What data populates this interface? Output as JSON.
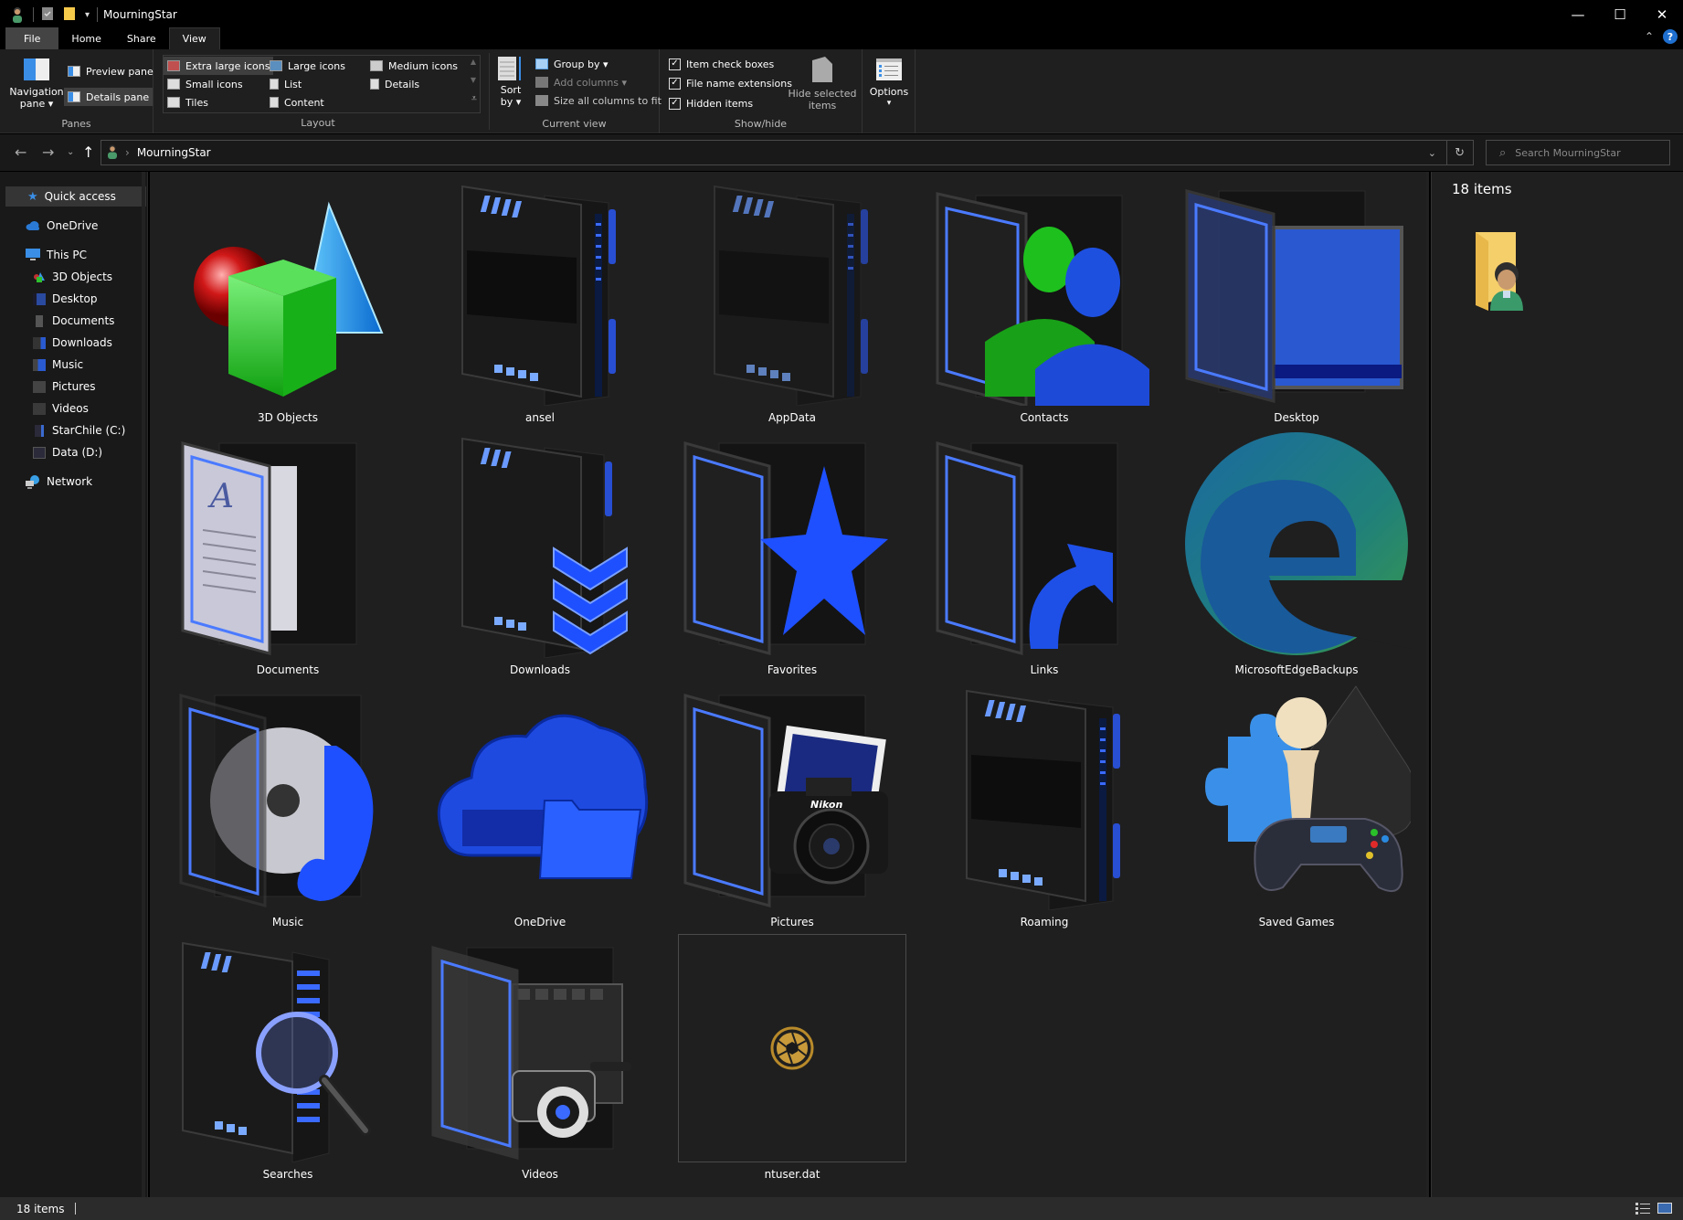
{
  "window": {
    "title": "MourningStar",
    "controls": {
      "minimize": "—",
      "maximize": "☐",
      "close": "✕"
    }
  },
  "ribbon_tabs": [
    "File",
    "Home",
    "Share",
    "View"
  ],
  "ribbon_active_tab": "View",
  "ribbon": {
    "panes": {
      "label": "Panes",
      "navigation_pane": "Navigation pane",
      "navigation_pane_line1": "Navigation",
      "navigation_pane_line2": "pane ▾",
      "preview_pane": "Preview pane",
      "details_pane": "Details pane"
    },
    "layout": {
      "label": "Layout",
      "options": [
        "Extra large icons",
        "Large icons",
        "Medium icons",
        "Small icons",
        "List",
        "Details",
        "Tiles",
        "Content"
      ],
      "selected": "Extra large icons"
    },
    "current_view": {
      "label": "Current view",
      "sort_line1": "Sort",
      "sort_line2": "by ▾",
      "group_by": "Group by ▾",
      "add_columns": "Add columns ▾",
      "size_columns": "Size all columns to fit"
    },
    "show_hide": {
      "label": "Show/hide",
      "item_check_boxes": "Item check boxes",
      "file_name_extensions": "File name extensions",
      "hidden_items": "Hidden items",
      "item_check_boxes_checked": true,
      "file_name_extensions_checked": true,
      "hidden_items_checked": true,
      "hide_selected_line1": "Hide selected",
      "hide_selected_line2": "items"
    },
    "options": {
      "label": "Options",
      "caret": "▾"
    }
  },
  "address_bar": {
    "path": [
      "MourningStar"
    ],
    "separator": "›",
    "search_placeholder": "Search MourningStar"
  },
  "nav": {
    "quick_access": "Quick access",
    "onedrive": "OneDrive",
    "this_pc": "This PC",
    "pc_items": [
      "3D Objects",
      "Desktop",
      "Documents",
      "Downloads",
      "Music",
      "Pictures",
      "Videos",
      "StarChile (C:)",
      "Data (D:)"
    ],
    "network": "Network"
  },
  "items": [
    {
      "name": "3D Objects",
      "icon": "3d-objects-icon"
    },
    {
      "name": "ansel",
      "icon": "tech-folder-icon"
    },
    {
      "name": "AppData",
      "icon": "tech-folder-icon"
    },
    {
      "name": "Contacts",
      "icon": "contacts-folder-icon"
    },
    {
      "name": "Desktop",
      "icon": "desktop-folder-icon"
    },
    {
      "name": "Documents",
      "icon": "documents-folder-icon"
    },
    {
      "name": "Downloads",
      "icon": "downloads-folder-icon"
    },
    {
      "name": "Favorites",
      "icon": "favorites-folder-icon"
    },
    {
      "name": "Links",
      "icon": "links-folder-icon"
    },
    {
      "name": "MicrosoftEdgeBackups",
      "icon": "edge-icon"
    },
    {
      "name": "Music",
      "icon": "music-folder-icon"
    },
    {
      "name": "OneDrive",
      "icon": "onedrive-cloud-icon"
    },
    {
      "name": "Pictures",
      "icon": "pictures-folder-icon"
    },
    {
      "name": "Roaming",
      "icon": "tech-folder-icon"
    },
    {
      "name": "Saved Games",
      "icon": "saved-games-icon"
    },
    {
      "name": "Searches",
      "icon": "searches-folder-icon"
    },
    {
      "name": "Videos",
      "icon": "videos-folder-icon"
    },
    {
      "name": "ntuser.dat",
      "icon": "aperture-file-icon"
    }
  ],
  "details_pane": {
    "count": "18 items"
  },
  "status_bar": {
    "count": "18 items"
  },
  "colors": {
    "accent_blue": "#1e5bff",
    "background": "#1f1f1f",
    "titlebar": "#000000"
  }
}
